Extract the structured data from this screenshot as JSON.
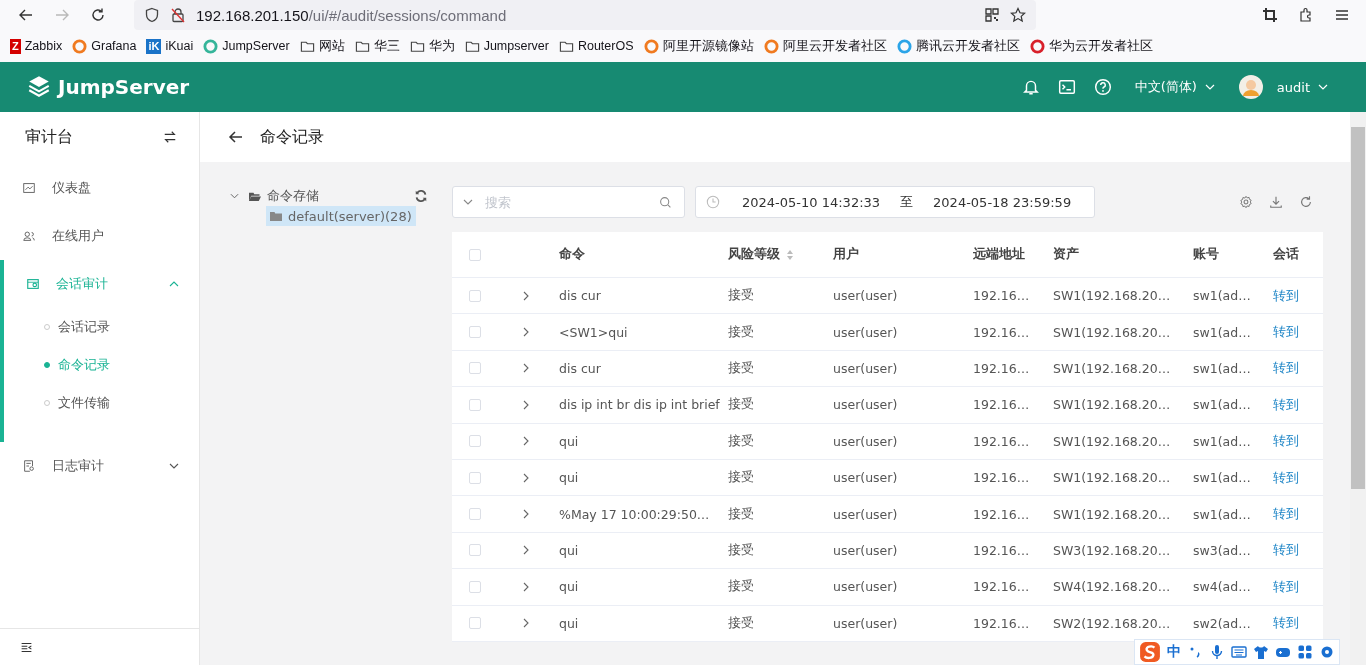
{
  "browser": {
    "url_host": "192.168.201.150",
    "url_path": "/ui/#/audit/sessions/command",
    "back_disabled": false,
    "forward_disabled": true
  },
  "bookmarks": [
    {
      "kind": "site",
      "label": "Zabbix",
      "color": "#d40000",
      "glyph": "Z"
    },
    {
      "kind": "site",
      "label": "Grafana",
      "color": "#f07a20"
    },
    {
      "kind": "site",
      "label": "iKuai",
      "color": "#1a73c8",
      "glyph": "iK"
    },
    {
      "kind": "site",
      "label": "JumpServer",
      "color": "#35b59a"
    },
    {
      "kind": "folder",
      "label": "网站"
    },
    {
      "kind": "folder",
      "label": "华三"
    },
    {
      "kind": "folder",
      "label": "华为"
    },
    {
      "kind": "folder",
      "label": "Jumpserver"
    },
    {
      "kind": "folder",
      "label": "RouterOS"
    },
    {
      "kind": "site",
      "label": "阿里开源镜像站",
      "color": "#f07a20"
    },
    {
      "kind": "site",
      "label": "阿里云开发者社区",
      "color": "#f07a20"
    },
    {
      "kind": "site",
      "label": "腾讯云开发者社区",
      "color": "#2ba4e8"
    },
    {
      "kind": "site",
      "label": "华为云开发者社区",
      "color": "#d8202a"
    }
  ],
  "app_header": {
    "brand": "JumpServer",
    "language": "中文(简体)",
    "user": "audit"
  },
  "sidebar": {
    "title": "审计台",
    "items": [
      {
        "label": "仪表盘",
        "selected": false
      },
      {
        "label": "在线用户",
        "selected": false
      },
      {
        "label": "会话审计",
        "expanded": true,
        "selected": true,
        "children": [
          {
            "label": "会话记录",
            "selected": false
          },
          {
            "label": "命令记录",
            "selected": true
          },
          {
            "label": "文件传输",
            "selected": false
          }
        ]
      },
      {
        "label": "日志审计",
        "expanded": false,
        "selected": false
      }
    ]
  },
  "page": {
    "title": "命令记录"
  },
  "tree": {
    "root": "命令存储",
    "expanded": true,
    "children": [
      {
        "label": "default(server)(28)",
        "selected": true
      }
    ]
  },
  "toolbar": {
    "search_placeholder": "搜索",
    "date_from": "2024-05-10 14:32:33",
    "date_sep": "至",
    "date_to": "2024-05-18 23:59:59"
  },
  "table": {
    "header_checked": false,
    "columns": [
      {
        "label": "命令",
        "sortable": false
      },
      {
        "label": "风险等级",
        "sortable": true
      },
      {
        "label": "用户",
        "sortable": false
      },
      {
        "label": "远端地址",
        "sortable": false
      },
      {
        "label": "资产",
        "sortable": false
      },
      {
        "label": "账号",
        "sortable": false
      },
      {
        "label": "会话",
        "sortable": false
      }
    ],
    "rows": [
      {
        "checked": false,
        "command": "dis cur",
        "risk": "接受",
        "user": "user(user)",
        "remote": "192.16…",
        "asset": "SW1(192.168.20…",
        "account": "sw1(ad…",
        "action": "转到"
      },
      {
        "checked": false,
        "command": "<SW1>qui",
        "risk": "接受",
        "user": "user(user)",
        "remote": "192.16…",
        "asset": "SW1(192.168.20…",
        "account": "sw1(ad…",
        "action": "转到"
      },
      {
        "checked": false,
        "command": "dis cur",
        "risk": "接受",
        "user": "user(user)",
        "remote": "192.16…",
        "asset": "SW1(192.168.20…",
        "account": "sw1(ad…",
        "action": "转到"
      },
      {
        "checked": false,
        "command": "dis ip int br dis ip int brief",
        "risk": "接受",
        "user": "user(user)",
        "remote": "192.16…",
        "asset": "SW1(192.168.20…",
        "account": "sw1(ad…",
        "action": "转到"
      },
      {
        "checked": false,
        "command": "qui",
        "risk": "接受",
        "user": "user(user)",
        "remote": "192.16…",
        "asset": "SW1(192.168.20…",
        "account": "sw1(ad…",
        "action": "转到"
      },
      {
        "checked": false,
        "command": "qui",
        "risk": "接受",
        "user": "user(user)",
        "remote": "192.16…",
        "asset": "SW1(192.168.20…",
        "account": "sw1(ad…",
        "action": "转到"
      },
      {
        "checked": false,
        "command": "%May 17 10:00:29:50…",
        "risk": "接受",
        "user": "user(user)",
        "remote": "192.16…",
        "asset": "SW1(192.168.20…",
        "account": "sw1(ad…",
        "action": "转到"
      },
      {
        "checked": false,
        "command": "qui",
        "risk": "接受",
        "user": "user(user)",
        "remote": "192.16…",
        "asset": "SW3(192.168.20…",
        "account": "sw3(ad…",
        "action": "转到"
      },
      {
        "checked": false,
        "command": "qui",
        "risk": "接受",
        "user": "user(user)",
        "remote": "192.16…",
        "asset": "SW4(192.168.20…",
        "account": "sw4(ad…",
        "action": "转到"
      },
      {
        "checked": false,
        "command": "qui",
        "risk": "接受",
        "user": "user(user)",
        "remote": "192.16…",
        "asset": "SW2(192.168.20…",
        "account": "sw2(ad…",
        "action": "转到"
      }
    ]
  },
  "ime_toolbar": {
    "mode": "中"
  }
}
